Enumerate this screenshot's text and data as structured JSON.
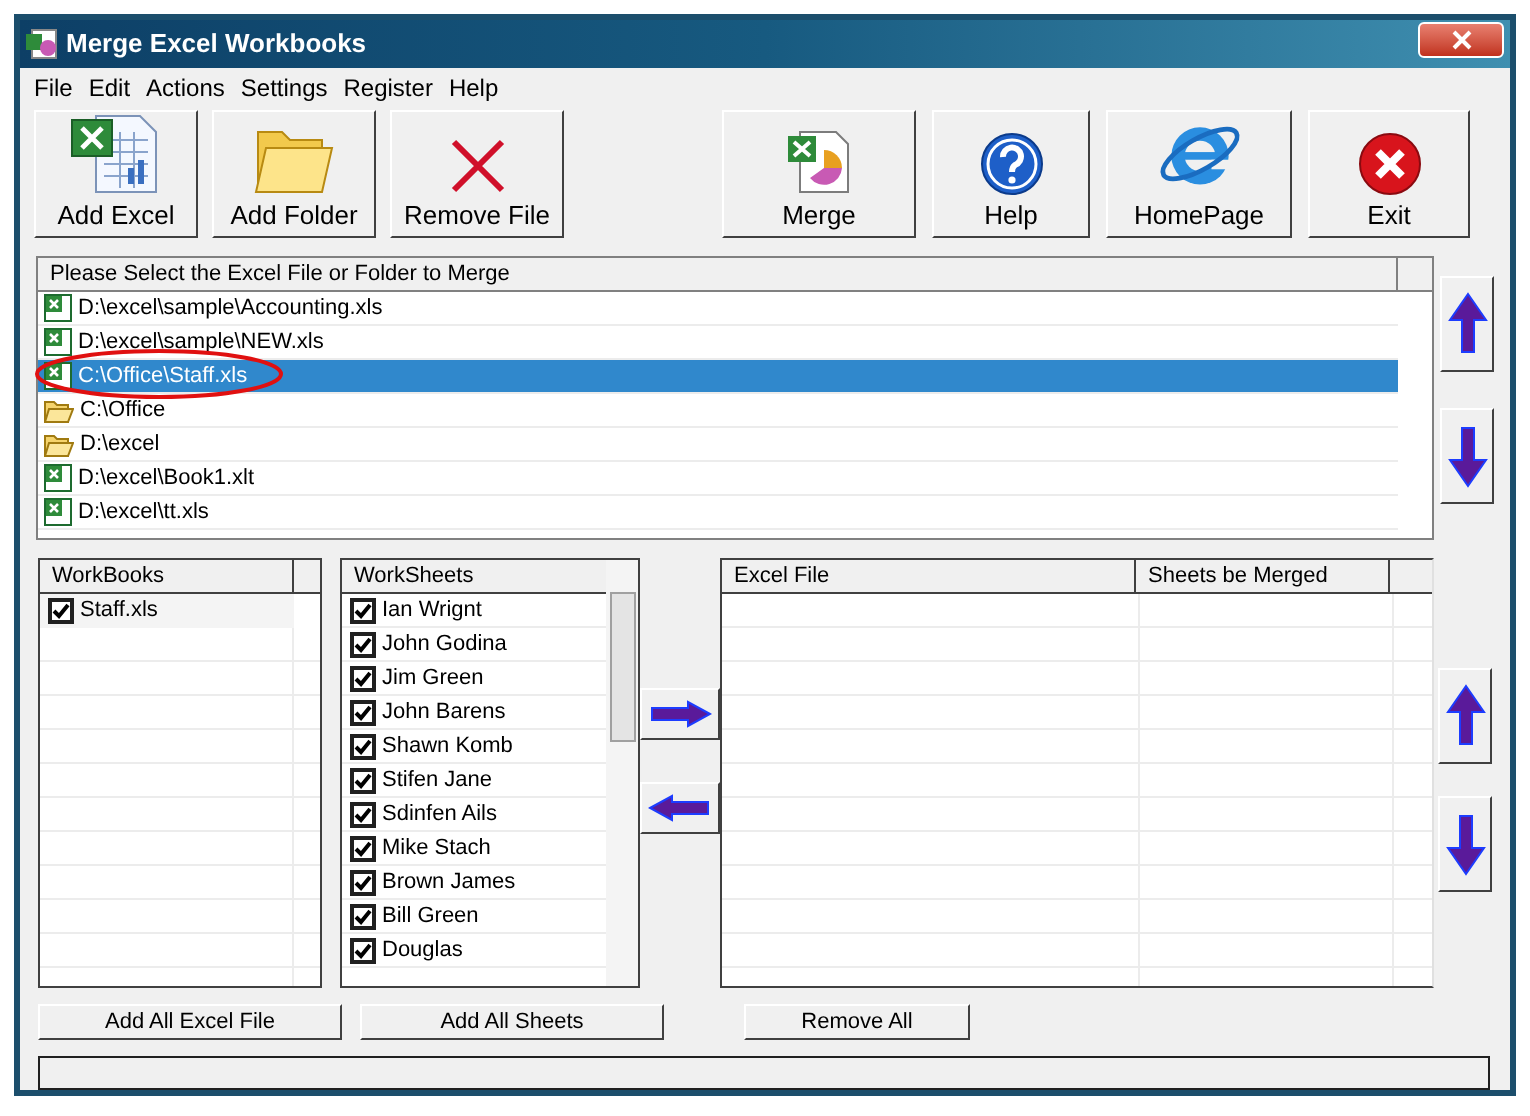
{
  "window": {
    "title": "Merge Excel Workbooks"
  },
  "menu": [
    "File",
    "Edit",
    "Actions",
    "Settings",
    "Register",
    "Help"
  ],
  "toolbar": [
    {
      "kind": "excel",
      "label": "Add Excel"
    },
    {
      "kind": "folder",
      "label": "Add Folder"
    },
    {
      "kind": "remove",
      "label": "Remove File"
    },
    {
      "kind": "merge",
      "label": "Merge"
    },
    {
      "kind": "help",
      "label": "Help"
    },
    {
      "kind": "homepage",
      "label": "HomePage"
    },
    {
      "kind": "exit",
      "label": "Exit"
    }
  ],
  "file_list": {
    "header": "Please Select the Excel File or Folder to Merge",
    "items": [
      {
        "kind": "excel",
        "path": "D:\\excel\\sample\\Accounting.xls",
        "selected": false
      },
      {
        "kind": "excel",
        "path": "D:\\excel\\sample\\NEW.xls",
        "selected": false
      },
      {
        "kind": "excel",
        "path": "C:\\Office\\Staff.xls",
        "selected": true
      },
      {
        "kind": "folder",
        "path": "C:\\Office",
        "selected": false
      },
      {
        "kind": "folder",
        "path": "D:\\excel",
        "selected": false
      },
      {
        "kind": "excel",
        "path": "D:\\excel\\Book1.xlt",
        "selected": false
      },
      {
        "kind": "excel",
        "path": "D:\\excel\\tt.xls",
        "selected": false
      }
    ]
  },
  "workbooks": {
    "header": "WorkBooks",
    "items": [
      {
        "name": "Staff.xls",
        "checked": true
      }
    ]
  },
  "worksheets": {
    "header": "WorkSheets",
    "items": [
      {
        "name": "Ian Wrignt",
        "checked": true
      },
      {
        "name": "John Godina",
        "checked": true
      },
      {
        "name": "Jim Green",
        "checked": true
      },
      {
        "name": "John Barens",
        "checked": true
      },
      {
        "name": "Shawn Komb",
        "checked": true
      },
      {
        "name": "Stifen Jane",
        "checked": true
      },
      {
        "name": "Sdinfen Ails",
        "checked": true
      },
      {
        "name": "Mike Stach",
        "checked": true
      },
      {
        "name": "Brown James",
        "checked": true
      },
      {
        "name": "Bill Green",
        "checked": true
      },
      {
        "name": "Douglas",
        "checked": true
      }
    ]
  },
  "merge_table": {
    "columns": [
      "Excel File",
      "Sheets be Merged"
    ]
  },
  "buttons": [
    "Add All Excel File",
    "Add All Sheets",
    "Remove All"
  ]
}
